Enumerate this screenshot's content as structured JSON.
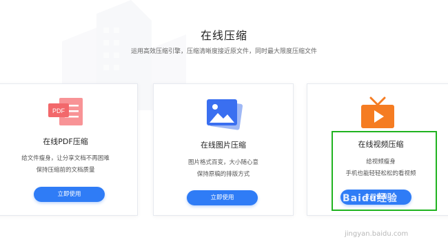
{
  "header": {
    "title": "在线压缩",
    "subtitle": "运用高效压缩引擎，压缩清晰度接近原文件，同时最大限度压缩文件"
  },
  "cards": [
    {
      "title": "在线PDF压缩",
      "desc_line1": "给文件瘦身，让分享文档不再困难",
      "desc_line2": "保持压缩前的文档质量",
      "button": "立即使用",
      "icon": "pdf-icon",
      "icon_label": "PDF"
    },
    {
      "title": "在线图片压缩",
      "desc_line1": "图片格式百变，大小随心意",
      "desc_line2": "保持原稿的排版方式",
      "button": "立即使用",
      "icon": "image-icon"
    },
    {
      "title": "在线视频压缩",
      "desc_line1": "给视频瘦身",
      "desc_line2": "手机也能轻轻松松的看视频",
      "button": "立即使用",
      "icon": "tv-play-icon"
    }
  ],
  "watermark": {
    "brand": "Baidu经验",
    "url": "jingyan.baidu.com"
  },
  "colors": {
    "accent": "#2f7cf6",
    "pdf": "#f2686b",
    "image": "#3a6ff0",
    "video": "#f57c22",
    "highlight": "#1fb31f"
  }
}
